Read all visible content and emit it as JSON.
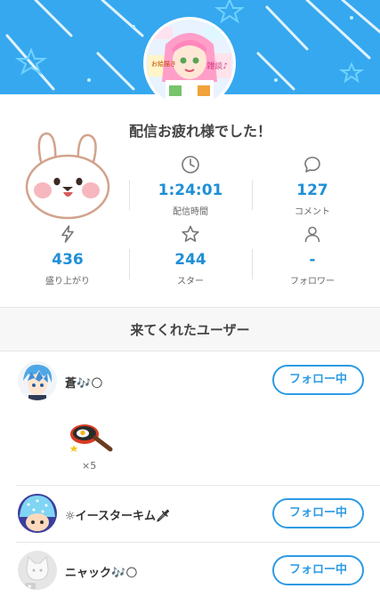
{
  "header": {
    "title": "配信お疲れ様でした！",
    "colors": {
      "banner": "#36a8ef",
      "accent": "#1f8fd6"
    },
    "avatar_stickers": [
      "雑談♪",
      "お絵描き"
    ]
  },
  "stats": [
    {
      "icon": "clock-icon",
      "value": "1:24:01",
      "label": "配信時間"
    },
    {
      "icon": "comment-icon",
      "value": "127",
      "label": "コメント"
    },
    {
      "icon": "lightning-icon",
      "value": "436",
      "label": "盛り上がり"
    },
    {
      "icon": "star-icon",
      "value": "244",
      "label": "スター"
    },
    {
      "icon": "person-icon",
      "value": "-",
      "label": "フォロワー"
    }
  ],
  "visitors": {
    "title": "来てくれたユーザー",
    "users": [
      {
        "name": "蒼🎶🌕",
        "button": "フォロー中",
        "gift_count": "×5"
      },
      {
        "name": "☼イースターキム🗡",
        "button": "フォロー中"
      },
      {
        "name": "ニャック🎶🌕",
        "button": "フォロー中"
      }
    ]
  }
}
